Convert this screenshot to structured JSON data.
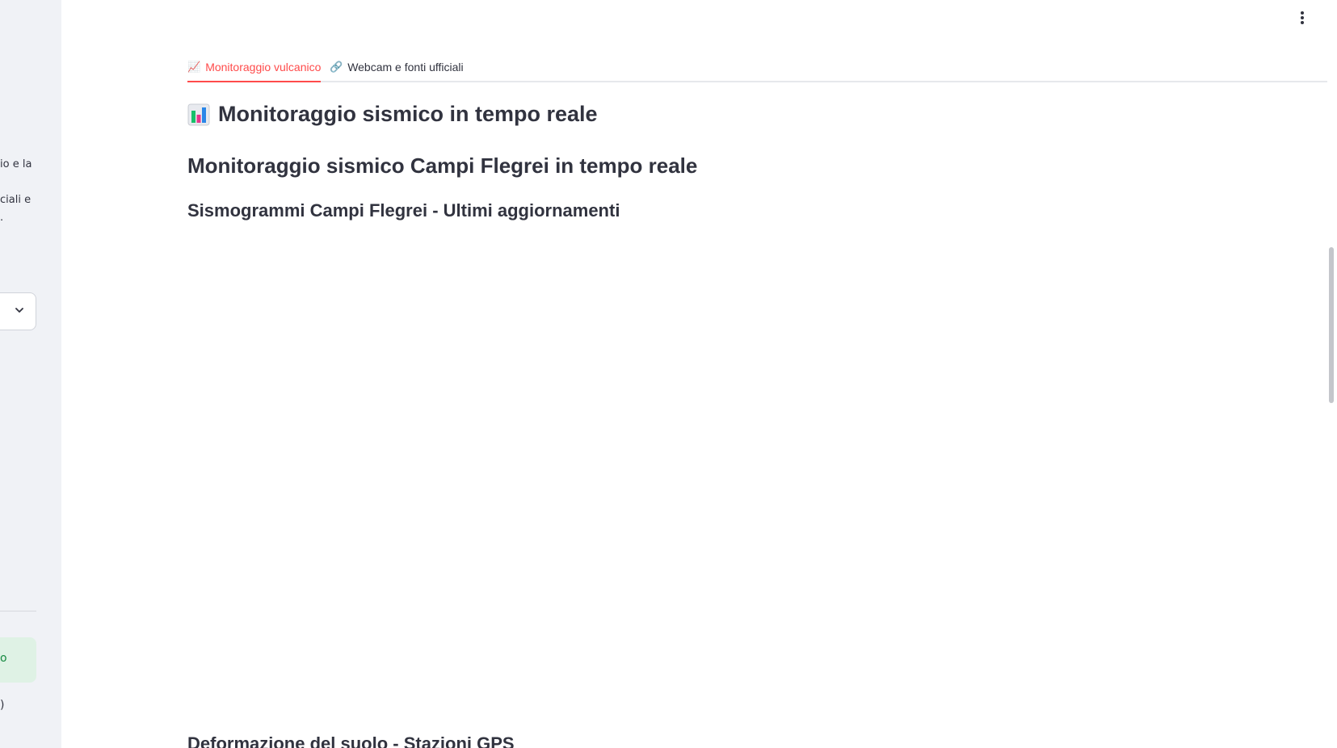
{
  "sidebar": {
    "text_fragments": [
      "io e la",
      "ciali e",
      "."
    ],
    "select_chevron_icon": "chevron-down-icon",
    "success_text": "o",
    "footer_fragment": ")"
  },
  "header": {
    "menu_icon": "more-vertical-icon"
  },
  "tabs": [
    {
      "icon": "📈",
      "label": "Monitoraggio vulcanico",
      "active": true
    },
    {
      "icon": "🔗",
      "label": "Webcam e fonti ufficiali",
      "active": false
    }
  ],
  "main": {
    "title_icon": "📊",
    "title": "Monitoraggio sismico in tempo reale",
    "subtitle": "Monitoraggio sismico Campi Flegrei in tempo reale",
    "section_heading": "Sismogrammi Campi Flegrei - Ultimi aggiornamenti",
    "next_section_heading": "Deformazione del suolo - Stazioni GPS"
  },
  "colors": {
    "accent": "#ff4b4b",
    "sidebar_bg": "#f0f2f6",
    "text": "#31333f",
    "success_bg": "#dff2e5",
    "success_text": "#178a42"
  }
}
